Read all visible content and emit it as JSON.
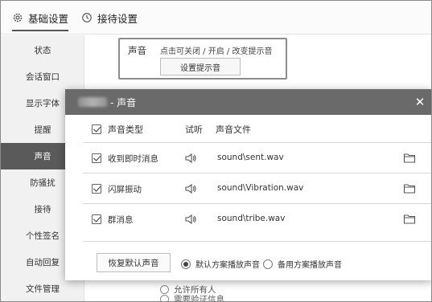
{
  "top_tabs": [
    {
      "label": "基础设置",
      "icon": "gear-icon"
    },
    {
      "label": "接待设置",
      "icon": "clock-icon"
    }
  ],
  "sidebar": {
    "items": [
      {
        "label": "状态"
      },
      {
        "label": "会话窗口"
      },
      {
        "label": "显示字体"
      },
      {
        "label": "提醒"
      },
      {
        "label": "声音"
      },
      {
        "label": "防骚扰"
      },
      {
        "label": "接待"
      },
      {
        "label": "个性签名"
      },
      {
        "label": "自动回复"
      },
      {
        "label": "文件管理"
      }
    ],
    "active_label": "声音"
  },
  "main": {
    "sound_label": "声音",
    "sound_desc": "点击可关闭 / 开启 / 改变提示音",
    "set_sound_button": "设置提示音",
    "bg_line_1": "允许所有人",
    "bg_line_2": "需要验证信息"
  },
  "dialog": {
    "title_suffix": "- 声音",
    "close_icon": "close-icon",
    "headers": {
      "type": "声音类型",
      "listen": "试听",
      "file": "声音文件"
    },
    "rows": [
      {
        "checked": true,
        "name": "收到即时消息",
        "file": "sound\\sent.wav"
      },
      {
        "checked": true,
        "name": "闪屏振动",
        "file": "sound\\Vibration.wav"
      },
      {
        "checked": true,
        "name": "群消息",
        "file": "sound\\tribe.wav"
      }
    ],
    "restore_button": "恢复默认声音",
    "radio_default": "默认方案播放声音",
    "radio_backup": "备用方案播放声音",
    "selected_radio": "默认方案播放声音"
  }
}
